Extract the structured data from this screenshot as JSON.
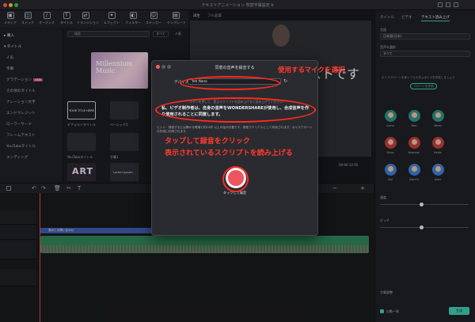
{
  "window": {
    "title": "テキストアニメーション 吹替字幕設定 b"
  },
  "toolbar": {
    "items": [
      "メディア",
      "ストック",
      "オーディオ",
      "タイトル",
      "トランジション",
      "エフェクト",
      "フィルター",
      "ステッカー",
      "テンプレート"
    ],
    "icons": [
      "media-icon",
      "stock-icon",
      "audio-icon",
      "title-icon",
      "transition-icon",
      "effect-icon",
      "filter-icon",
      "sticker-icon",
      "template-icon"
    ]
  },
  "sidebar": {
    "header": "購入",
    "section": "タイトル",
    "items": [
      {
        "label": "人気"
      },
      {
        "label": "字幕"
      },
      {
        "label": "グラデーション",
        "badge": "NEW"
      },
      {
        "label": "その他のタイトル"
      },
      {
        "label": "ナレーション文字"
      },
      {
        "label": "エンドクレジット"
      },
      {
        "label": "ローワーサード"
      },
      {
        "label": "フレームテキスト"
      },
      {
        "label": "YouTubeタイトル"
      },
      {
        "label": "エンディング"
      }
    ]
  },
  "media": {
    "search_placeholder": "検索",
    "filter": "すべて",
    "sort": "人気",
    "banner_text": "Millennium Music",
    "thumbs": [
      {
        "label": "デフォルトタイトル",
        "text": "YOUR TITLE HERE"
      },
      {
        "label": "ベーシック1",
        "text": ""
      },
      {
        "label": "YouTubeタイトル",
        "text": ""
      },
      {
        "label": "字幕1",
        "text": ""
      },
      {
        "label": "",
        "text": "ART"
      },
      {
        "label": "",
        "text": "Lorem Ipsum"
      }
    ]
  },
  "preview": {
    "tab_player": "再生",
    "tab_full": "フル品質",
    "overlay_text": "ストです",
    "time": "00:00:12:05"
  },
  "right_panel": {
    "tabs": [
      "タイトル",
      "ビデオ",
      "テキスト読み上げ"
    ],
    "language_label": "言語",
    "language_value": "日本語(日本)",
    "voice_label": "音声を選択",
    "voice_value": "すべて",
    "clone_note": "ボイスクローンを使ってカスタムボイスを作成しましょう",
    "clone_button": "クローンを作成",
    "avatars": [
      "Anna",
      "Bob",
      "Mikel",
      "Dara",
      "Nanami",
      "Keita",
      "Aoi",
      "Daichi",
      "Alex"
    ],
    "speed_label": "速度",
    "pitch_label": "ピッチ",
    "auto_label": "自動一致",
    "auto_sub": "字幕調整",
    "ok_label": "生成"
  },
  "timeline": {
    "text_clip_label": "表示とお問い合わせ"
  },
  "modal": {
    "title": "同意の音声を録音する",
    "device_label": "デバイス",
    "device_value": "Yeti Nano",
    "faded_note": "…ボタンを押して、提示スクリプトを読み上げると読み上げてください…",
    "consent": "私、ビデオ制作者は、自身の音声をWONDERSHAREが使用し、合成音声を作り使用されることに同意します。",
    "hint": "ヒント：録音するには静かな環境で約15秒 以上の話が必要です。録音マテリアルとして利用されます。ボイスクローンの作成に利用されます。",
    "record_label": "タップして録音"
  },
  "annotations": {
    "select_mic": "使用するマイクを選択",
    "tap_line1": "タップして録音をクリック",
    "tap_line2": "表示されているスクリプトを読み上げる"
  },
  "colors": {
    "accent_red": "#ff2a1f",
    "record_red": "#ee5560",
    "text_clip": "#3e5aa6",
    "video_clip": "#2f7e56"
  }
}
